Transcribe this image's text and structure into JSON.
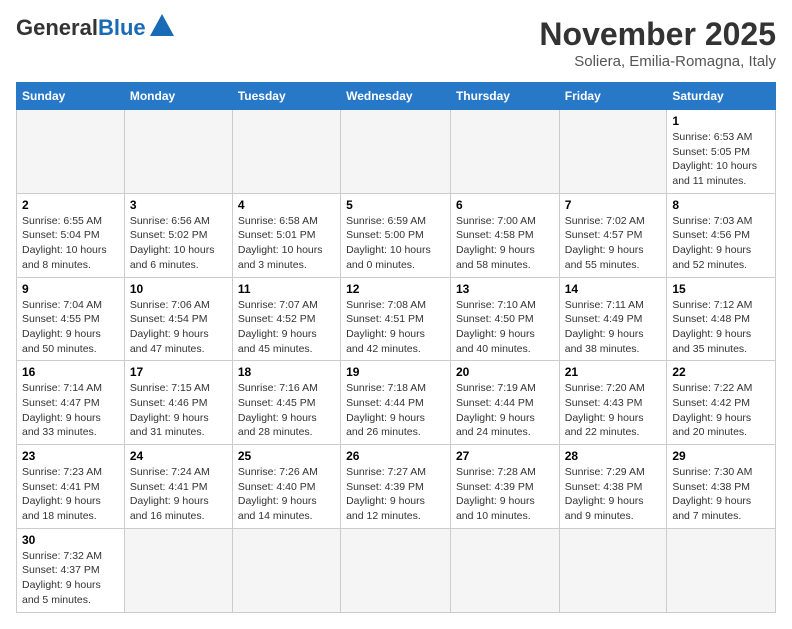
{
  "header": {
    "logo_general": "General",
    "logo_blue": "Blue",
    "title": "November 2025",
    "subtitle": "Soliera, Emilia-Romagna, Italy"
  },
  "days_of_week": [
    "Sunday",
    "Monday",
    "Tuesday",
    "Wednesday",
    "Thursday",
    "Friday",
    "Saturday"
  ],
  "weeks": [
    [
      {
        "day": "",
        "info": ""
      },
      {
        "day": "",
        "info": ""
      },
      {
        "day": "",
        "info": ""
      },
      {
        "day": "",
        "info": ""
      },
      {
        "day": "",
        "info": ""
      },
      {
        "day": "",
        "info": ""
      },
      {
        "day": "1",
        "info": "Sunrise: 6:53 AM\nSunset: 5:05 PM\nDaylight: 10 hours and 11 minutes."
      }
    ],
    [
      {
        "day": "2",
        "info": "Sunrise: 6:55 AM\nSunset: 5:04 PM\nDaylight: 10 hours and 8 minutes."
      },
      {
        "day": "3",
        "info": "Sunrise: 6:56 AM\nSunset: 5:02 PM\nDaylight: 10 hours and 6 minutes."
      },
      {
        "day": "4",
        "info": "Sunrise: 6:58 AM\nSunset: 5:01 PM\nDaylight: 10 hours and 3 minutes."
      },
      {
        "day": "5",
        "info": "Sunrise: 6:59 AM\nSunset: 5:00 PM\nDaylight: 10 hours and 0 minutes."
      },
      {
        "day": "6",
        "info": "Sunrise: 7:00 AM\nSunset: 4:58 PM\nDaylight: 9 hours and 58 minutes."
      },
      {
        "day": "7",
        "info": "Sunrise: 7:02 AM\nSunset: 4:57 PM\nDaylight: 9 hours and 55 minutes."
      },
      {
        "day": "8",
        "info": "Sunrise: 7:03 AM\nSunset: 4:56 PM\nDaylight: 9 hours and 52 minutes."
      }
    ],
    [
      {
        "day": "9",
        "info": "Sunrise: 7:04 AM\nSunset: 4:55 PM\nDaylight: 9 hours and 50 minutes."
      },
      {
        "day": "10",
        "info": "Sunrise: 7:06 AM\nSunset: 4:54 PM\nDaylight: 9 hours and 47 minutes."
      },
      {
        "day": "11",
        "info": "Sunrise: 7:07 AM\nSunset: 4:52 PM\nDaylight: 9 hours and 45 minutes."
      },
      {
        "day": "12",
        "info": "Sunrise: 7:08 AM\nSunset: 4:51 PM\nDaylight: 9 hours and 42 minutes."
      },
      {
        "day": "13",
        "info": "Sunrise: 7:10 AM\nSunset: 4:50 PM\nDaylight: 9 hours and 40 minutes."
      },
      {
        "day": "14",
        "info": "Sunrise: 7:11 AM\nSunset: 4:49 PM\nDaylight: 9 hours and 38 minutes."
      },
      {
        "day": "15",
        "info": "Sunrise: 7:12 AM\nSunset: 4:48 PM\nDaylight: 9 hours and 35 minutes."
      }
    ],
    [
      {
        "day": "16",
        "info": "Sunrise: 7:14 AM\nSunset: 4:47 PM\nDaylight: 9 hours and 33 minutes."
      },
      {
        "day": "17",
        "info": "Sunrise: 7:15 AM\nSunset: 4:46 PM\nDaylight: 9 hours and 31 minutes."
      },
      {
        "day": "18",
        "info": "Sunrise: 7:16 AM\nSunset: 4:45 PM\nDaylight: 9 hours and 28 minutes."
      },
      {
        "day": "19",
        "info": "Sunrise: 7:18 AM\nSunset: 4:44 PM\nDaylight: 9 hours and 26 minutes."
      },
      {
        "day": "20",
        "info": "Sunrise: 7:19 AM\nSunset: 4:44 PM\nDaylight: 9 hours and 24 minutes."
      },
      {
        "day": "21",
        "info": "Sunrise: 7:20 AM\nSunset: 4:43 PM\nDaylight: 9 hours and 22 minutes."
      },
      {
        "day": "22",
        "info": "Sunrise: 7:22 AM\nSunset: 4:42 PM\nDaylight: 9 hours and 20 minutes."
      }
    ],
    [
      {
        "day": "23",
        "info": "Sunrise: 7:23 AM\nSunset: 4:41 PM\nDaylight: 9 hours and 18 minutes."
      },
      {
        "day": "24",
        "info": "Sunrise: 7:24 AM\nSunset: 4:41 PM\nDaylight: 9 hours and 16 minutes."
      },
      {
        "day": "25",
        "info": "Sunrise: 7:26 AM\nSunset: 4:40 PM\nDaylight: 9 hours and 14 minutes."
      },
      {
        "day": "26",
        "info": "Sunrise: 7:27 AM\nSunset: 4:39 PM\nDaylight: 9 hours and 12 minutes."
      },
      {
        "day": "27",
        "info": "Sunrise: 7:28 AM\nSunset: 4:39 PM\nDaylight: 9 hours and 10 minutes."
      },
      {
        "day": "28",
        "info": "Sunrise: 7:29 AM\nSunset: 4:38 PM\nDaylight: 9 hours and 9 minutes."
      },
      {
        "day": "29",
        "info": "Sunrise: 7:30 AM\nSunset: 4:38 PM\nDaylight: 9 hours and 7 minutes."
      }
    ],
    [
      {
        "day": "30",
        "info": "Sunrise: 7:32 AM\nSunset: 4:37 PM\nDaylight: 9 hours and 5 minutes."
      },
      {
        "day": "",
        "info": ""
      },
      {
        "day": "",
        "info": ""
      },
      {
        "day": "",
        "info": ""
      },
      {
        "day": "",
        "info": ""
      },
      {
        "day": "",
        "info": ""
      },
      {
        "day": "",
        "info": ""
      }
    ]
  ]
}
